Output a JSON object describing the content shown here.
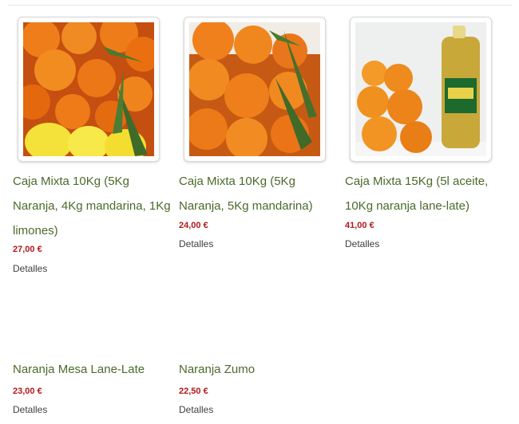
{
  "products": [
    {
      "title": "Caja Mixta 10Kg (5Kg Naranja, 4Kg mandarina, 1Kg limones)",
      "price": "27,00 €",
      "details_label": "Detalles",
      "image": "mixed-oranges-lemons-photo"
    },
    {
      "title": "Caja Mixta 10Kg (5Kg Naranja, 5Kg mandarina)",
      "price": "24,00 €",
      "details_label": "Detalles",
      "image": "oranges-mandarins-photo"
    },
    {
      "title": "Caja Mixta 15Kg (5l aceite, 10Kg naranja lane-late)",
      "price": "41,00 €",
      "details_label": "Detalles",
      "image": "oranges-olive-oil-photo"
    },
    {
      "title": "Naranja Mesa Lane-Late",
      "price": "23,00 €",
      "details_label": "Detalles"
    },
    {
      "title": "Naranja Zumo",
      "price": "22,50 €",
      "details_label": "Detalles"
    }
  ],
  "colors": {
    "title": "#4a6a2a",
    "price": "#b4181a",
    "link": "#3f3f3f"
  }
}
